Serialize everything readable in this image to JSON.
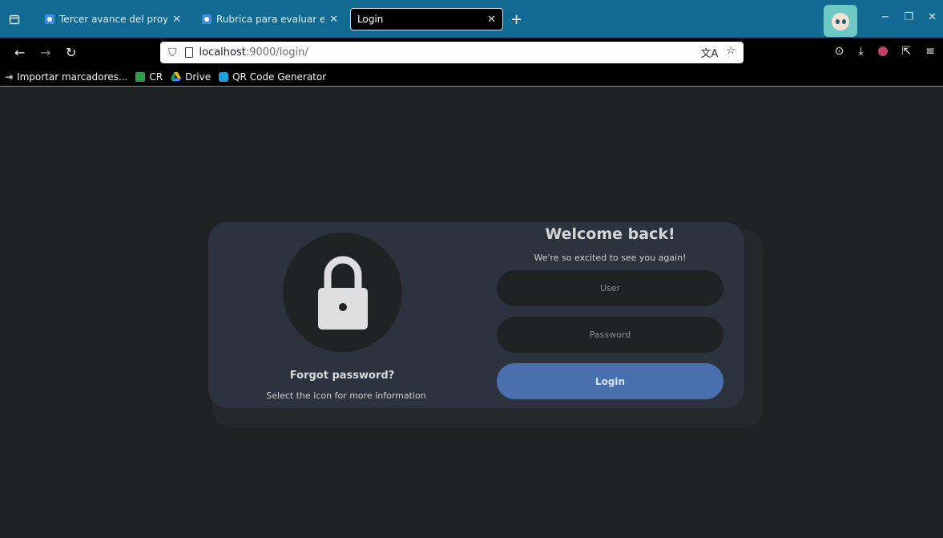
{
  "browser": {
    "tabs": [
      {
        "title": "Tercer avance del proyec",
        "active": false
      },
      {
        "title": "Rubrica para evaluar el p",
        "active": false
      },
      {
        "title": "Login",
        "active": true
      }
    ],
    "url_host": "localhost",
    "url_rest": ":9000/login/",
    "bookmarks": [
      {
        "label": "Importar marcadores...",
        "icon": "import-icon"
      },
      {
        "label": "CR",
        "icon": "cr-favicon"
      },
      {
        "label": "Drive",
        "icon": "drive-icon"
      },
      {
        "label": "QR Code Generator",
        "icon": "qr-icon"
      }
    ]
  },
  "login": {
    "title": "Welcome back!",
    "subtitle": "We're so excited to see you again!",
    "user_placeholder": "User",
    "password_placeholder": "Password",
    "button_label": "Login",
    "forgot_title": "Forgot password?",
    "forgot_subtitle": "Select the icon for more information"
  },
  "colors": {
    "tabstrip": "#126a93",
    "page_bg": "#1f2324",
    "card_bg": "#2c333f",
    "button_bg": "#4a6fae"
  }
}
